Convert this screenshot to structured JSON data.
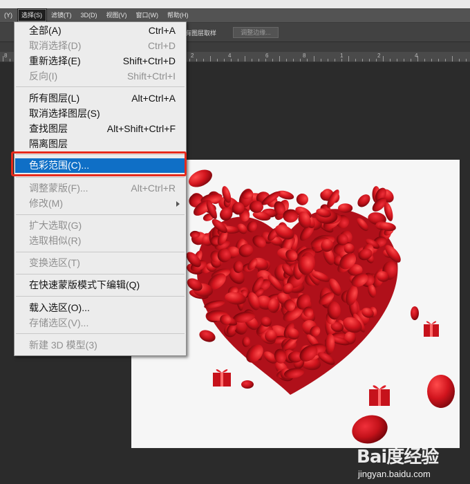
{
  "menubar": {
    "items": [
      {
        "label": "(Y)"
      },
      {
        "label": "选择(S)"
      },
      {
        "label": "滤镜(T)"
      },
      {
        "label": "3D(D)"
      },
      {
        "label": "视图(V)"
      },
      {
        "label": "窗口(W)"
      },
      {
        "label": "帮助(H)"
      }
    ]
  },
  "options_bar": {
    "sample_label": "有图层取样",
    "refine_edge_button": "调整边缘..."
  },
  "ruler": {
    "ticks": [
      "8",
      "6",
      "4",
      "2",
      "0",
      "2",
      "4",
      "6",
      "8",
      "1",
      "2",
      "4"
    ]
  },
  "select_menu": {
    "groups": [
      [
        {
          "label": "全部(A)",
          "shortcut": "Ctrl+A",
          "enabled": true
        },
        {
          "label": "取消选择(D)",
          "shortcut": "Ctrl+D",
          "enabled": false
        },
        {
          "label": "重新选择(E)",
          "shortcut": "Shift+Ctrl+D",
          "enabled": true
        },
        {
          "label": "反向(I)",
          "shortcut": "Shift+Ctrl+I",
          "enabled": false
        }
      ],
      [
        {
          "label": "所有图层(L)",
          "shortcut": "Alt+Ctrl+A",
          "enabled": true
        },
        {
          "label": "取消选择图层(S)",
          "shortcut": "",
          "enabled": true
        },
        {
          "label": "查找图层",
          "shortcut": "Alt+Shift+Ctrl+F",
          "enabled": true
        },
        {
          "label": "隔离图层",
          "shortcut": "",
          "enabled": true
        }
      ],
      [
        {
          "label": "色彩范围(C)...",
          "shortcut": "",
          "enabled": true,
          "highlighted": true
        }
      ],
      [
        {
          "label": "调整蒙版(F)...",
          "shortcut": "Alt+Ctrl+R",
          "enabled": false
        },
        {
          "label": "修改(M)",
          "shortcut": "",
          "enabled": false,
          "submenu": true
        }
      ],
      [
        {
          "label": "扩大选取(G)",
          "shortcut": "",
          "enabled": false
        },
        {
          "label": "选取相似(R)",
          "shortcut": "",
          "enabled": false
        }
      ],
      [
        {
          "label": "变换选区(T)",
          "shortcut": "",
          "enabled": false
        }
      ],
      [
        {
          "label": "在快速蒙版模式下编辑(Q)",
          "shortcut": "",
          "enabled": true
        }
      ],
      [
        {
          "label": "载入选区(O)...",
          "shortcut": "",
          "enabled": true
        },
        {
          "label": "存储选区(V)...",
          "shortcut": "",
          "enabled": false
        }
      ],
      [
        {
          "label": "新建 3D 模型(3)",
          "shortcut": "",
          "enabled": false
        }
      ]
    ]
  },
  "colors": {
    "highlight": "#0f6fc6",
    "annotation_box": "#e62a1c",
    "petal_red": "#c4121a"
  },
  "canvas_image": {
    "subject": "heart-of-rose-petals"
  },
  "watermark": {
    "logo": "Bai度经验",
    "url": "jingyan.baidu.com"
  }
}
